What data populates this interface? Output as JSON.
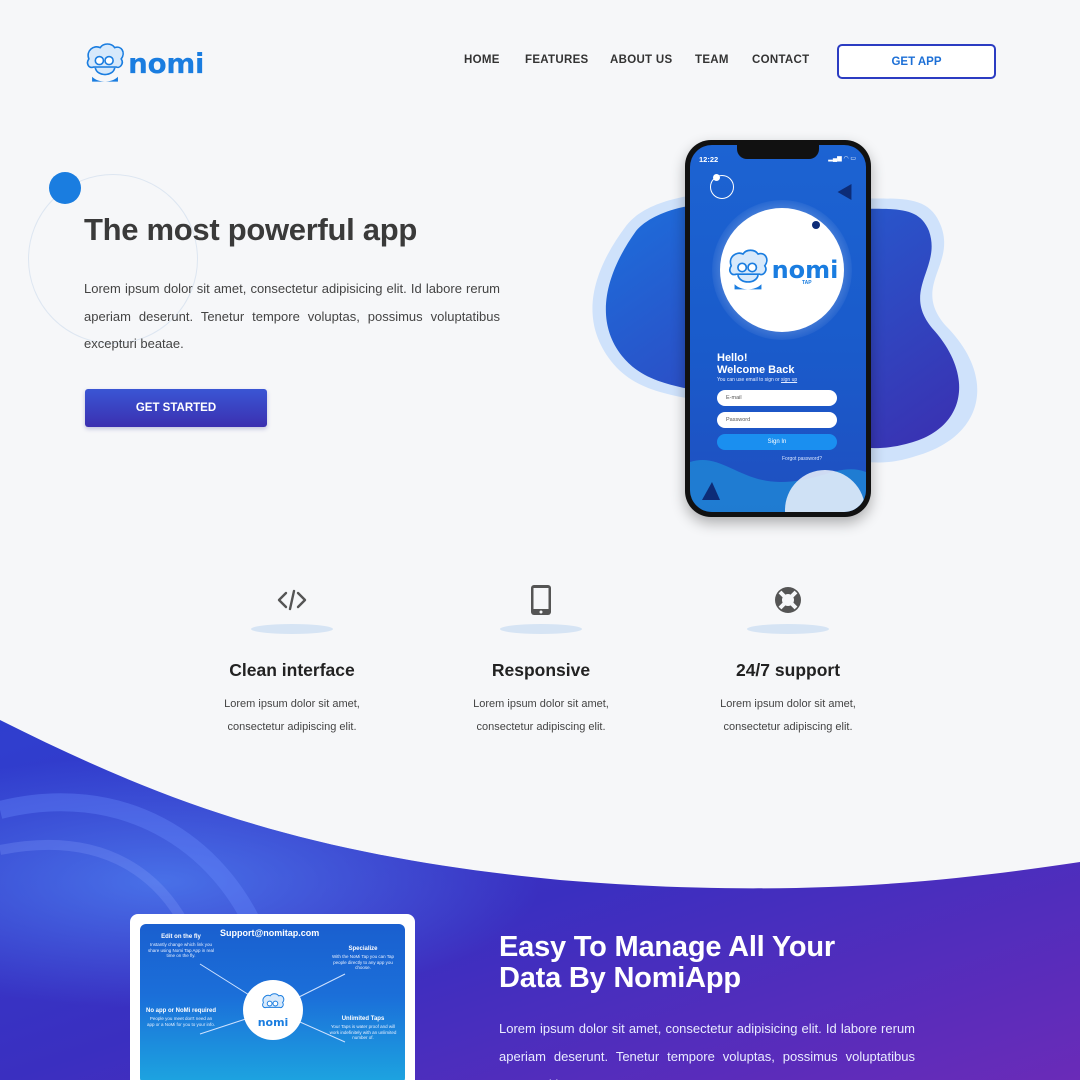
{
  "header": {
    "logo_text": "nomi",
    "nav": [
      "HOME",
      "FEATURES",
      "ABOUT US",
      "TEAM",
      "CONTACT"
    ],
    "cta_label": "GET APP"
  },
  "hero": {
    "title": "The most powerful app",
    "description": "Lorem ipsum dolor sit amet, consectetur adipisicing elit. Id labore rerum aperiam deserunt. Tenetur tempore voluptas, possimus voluptatibus excepturi beatae.",
    "button_label": "GET STARTED"
  },
  "phone": {
    "time": "12:22",
    "logo_text": "nomi",
    "logo_sub": "TAP",
    "greeting_line1": "Hello!",
    "greeting_line2": "Welcome Back",
    "hint_text": "You can use email to sign or",
    "hint_link": "sign up",
    "email_placeholder": "E-mail",
    "password_placeholder": "Password",
    "signin_label": "Sign In",
    "forgot_label": "Forgot password?"
  },
  "features": [
    {
      "icon": "code-icon",
      "title": "Clean interface",
      "desc_line1": "Lorem ipsum dolor sit amet,",
      "desc_line2": "consectetur adipiscing elit."
    },
    {
      "icon": "mobile-icon",
      "title": "Responsive",
      "desc_line1": "Lorem ipsum dolor sit amet,",
      "desc_line2": "consectetur adipiscing elit."
    },
    {
      "icon": "lifebuoy-icon",
      "title": "24/7 support",
      "desc_line1": "Lorem ipsum dolor sit amet,",
      "desc_line2": "consectetur adipiscing elit."
    }
  ],
  "infocard": {
    "email": "Support@nomitap.com",
    "center_text": "nomi",
    "blocks": [
      {
        "title": "Edit on the fly",
        "desc": "Instantly change which link you share using Nomi Tap App in real time on the fly."
      },
      {
        "title": "Specialize",
        "desc": "With the NoMi Tap you can Tap people directly to any app you choose."
      },
      {
        "title": "No app or NoMi required",
        "desc": "People you meet don't need an app or a NoMi for you to your info."
      },
      {
        "title": "Unlimited Taps",
        "desc": "Your Taps is water proof and will work indefinitely with an unlimited number of."
      }
    ]
  },
  "bottom": {
    "title_line1": "Easy To Manage All Your",
    "title_line2": "Data By NomiApp",
    "description": "Lorem ipsum dolor sit amet, consectetur adipisicing elit. Id labore rerum aperiam deserunt. Tenetur tempore voluptas, possimus voluptatibus excepturi beatae."
  },
  "colors": {
    "brand_blue": "#1a7de0",
    "accent_purple": "#3b2fb0",
    "background": "#f6f7f9"
  }
}
